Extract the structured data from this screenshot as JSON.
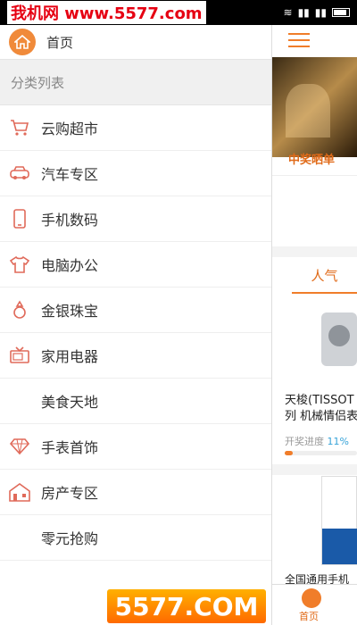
{
  "status_bar": {
    "watermark": "我机网 www.5577.com"
  },
  "drawer": {
    "home_label": "首页",
    "section_title": "分类列表",
    "categories": [
      {
        "label": "云购超市",
        "icon": "shopping-cart-icon"
      },
      {
        "label": "汽车专区",
        "icon": "car-icon"
      },
      {
        "label": "手机数码",
        "icon": "phone-icon"
      },
      {
        "label": "电脑办公",
        "icon": "shirt-icon"
      },
      {
        "label": "金银珠宝",
        "icon": "ring-icon"
      },
      {
        "label": "家用电器",
        "icon": "tv-icon"
      },
      {
        "label": "美食天地",
        "icon": ""
      },
      {
        "label": "手表首饰",
        "icon": "diamond-icon"
      },
      {
        "label": "房产专区",
        "icon": "house-icon"
      },
      {
        "label": "零元抢购",
        "icon": ""
      }
    ]
  },
  "main": {
    "winner_label": "中奖晒单",
    "tab_popular": "人气",
    "product_title_line1": "天梭(TISSOT",
    "product_title_line2": "列 机械情侣表",
    "progress_label": "开奖进度",
    "progress_value": "11%",
    "progress_fraction": 0.11,
    "ad_title": "全国通用手机",
    "bottom_nav_label": "首页"
  },
  "footer_logo": "5577.COM",
  "colors": {
    "accent": "#f07d2a",
    "progress_text": "#36a3d8"
  }
}
